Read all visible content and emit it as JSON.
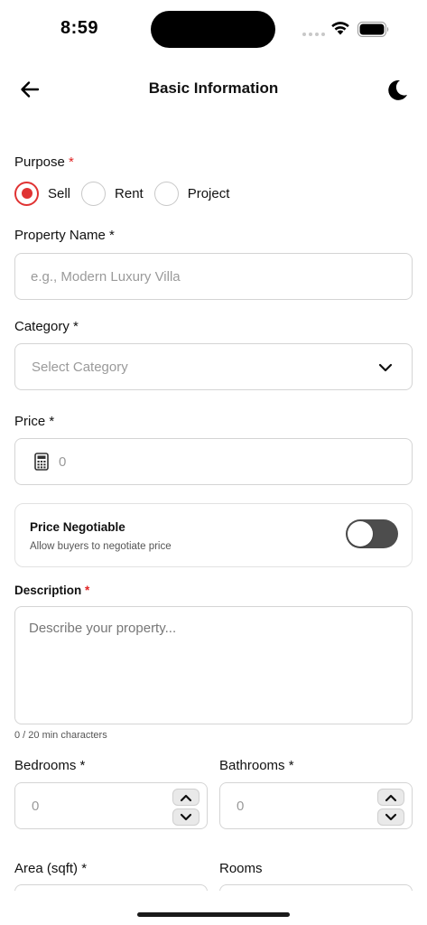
{
  "status_bar": {
    "time": "8:59",
    "icons": [
      "signal-dots-icon",
      "wifi-icon",
      "battery-icon"
    ]
  },
  "nav": {
    "back_icon": "arrow-left-icon",
    "title": "Basic Information",
    "theme_icon": "moon-icon"
  },
  "colors": {
    "accent": "#e03333",
    "required": "#e02424",
    "border": "#d4d4d4",
    "toggle_off": "#4d4d4d"
  },
  "form": {
    "purpose": {
      "label": "Purpose",
      "required_mark": "*",
      "options": [
        "Sell",
        "Rent",
        "Project"
      ],
      "selected": "Sell"
    },
    "property_name": {
      "label": "Property Name",
      "required_mark": "*",
      "placeholder": "e.g., Modern Luxury Villa",
      "value": ""
    },
    "category": {
      "label": "Category",
      "required_mark": "*",
      "selected_text": "Select Category",
      "icon": "chevron-down-icon"
    },
    "price": {
      "label": "Price",
      "required_mark": "*",
      "placeholder": "0",
      "icon": "calculator-icon"
    },
    "price_negotiable": {
      "title": "Price Negotiable",
      "subtitle": "Allow buyers to negotiate price",
      "enabled": false
    },
    "description": {
      "label": "Description",
      "required_mark": "*",
      "placeholder": "Describe your property...",
      "char_count": "0 / 20 min characters"
    },
    "bedrooms": {
      "label": "Bedrooms",
      "required_mark": "*",
      "placeholder": "0"
    },
    "bathrooms": {
      "label": "Bathrooms",
      "required_mark": "*",
      "placeholder": "0"
    },
    "area": {
      "label": "Area (sqft)",
      "required_mark": "*"
    },
    "rooms": {
      "label": "Rooms"
    }
  }
}
